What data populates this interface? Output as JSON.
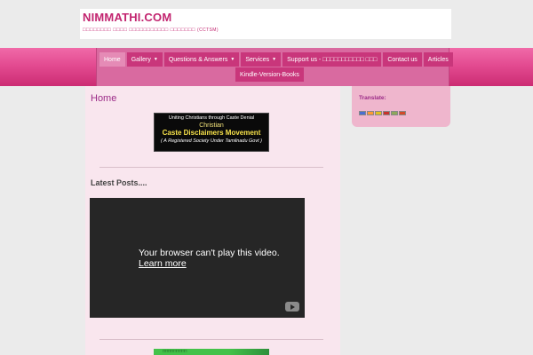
{
  "header": {
    "site_title": "NIMMATHI.COM",
    "tagline": "□□□□□□□□ □□□□ □□□□□□□□□□□ □□□□□□□",
    "tagline_abbr": "(CCTSM)"
  },
  "nav": {
    "row1": [
      {
        "label": "Home",
        "active": true,
        "has_caret": false
      },
      {
        "label": "Gallery",
        "has_caret": true
      },
      {
        "label": "Questions & Answers",
        "has_caret": true
      },
      {
        "label": "Services",
        "has_caret": true
      },
      {
        "label": "Support us - □□□□□□□□□□□ □□□"
      },
      {
        "label": "Contact us"
      },
      {
        "label": "Articles"
      }
    ],
    "row2": [
      {
        "label": "Kindle-Version-Books"
      }
    ],
    "caret_glyph": "▼"
  },
  "main": {
    "page_title": "Home",
    "banner": {
      "line1": "Uniting Christians through Caste Denial",
      "line2": "Christian",
      "line3": "Caste Disclaimers Movement",
      "line4": "( A Registered Society Under Tamilnadu Govt )"
    },
    "latest_heading": "Latest Posts....",
    "video": {
      "message": "Your browser can't play this video.",
      "link": "Learn more",
      "icon": "youtube-icon"
    },
    "bottom_image_text": "□□□□□□□□□"
  },
  "sidebar": {
    "translate_title": "Translate:",
    "flags": [
      {
        "name": "english-flag-icon",
        "color": "#4a6fd1"
      },
      {
        "name": "tamil-flag-icon",
        "color": "#ff9933"
      },
      {
        "name": "flag-icon-3",
        "color": "#e0c020"
      },
      {
        "name": "flag-icon-4",
        "color": "#c8322d"
      },
      {
        "name": "flag-icon-5",
        "color": "#8fa85a"
      },
      {
        "name": "flag-icon-6",
        "color": "#d24a2a"
      }
    ]
  },
  "colors": {
    "accent": "#c2246f",
    "nav_bg": "#d96aa0",
    "content_bg": "#f9e6ee"
  }
}
